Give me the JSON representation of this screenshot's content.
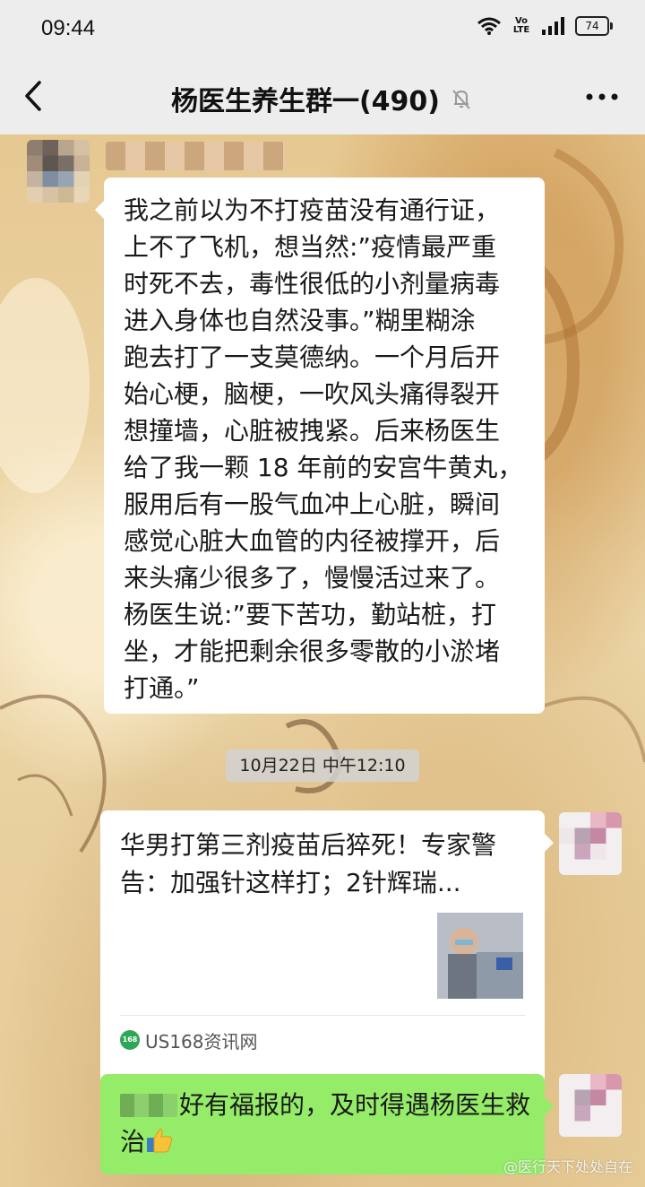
{
  "status_bar": {
    "time": "09:44",
    "network_label": "Vo LTE",
    "battery": "74"
  },
  "header": {
    "title": "杨医生养生群一(490)"
  },
  "messages": [
    {
      "text": "我之前以为不打疫苗没有通行证，\n上不了飞机，想当然:”疫情最严重\n时死不去，毒性很低的小剂量病毒\n进入身体也自然没事。”糊里糊涂\n跑去打了一支莫德纳。一个月后开\n始心梗，脑梗，一吹风头痛得裂开\n想撞墙，心脏被拽紧。后来杨医生\n给了我一颗 18 年前的安宫牛黄丸，\n服用后有一股气血冲上心脏，瞬间\n感觉心脏大血管的内径被撑开，后\n来头痛少很多了，慢慢活过来了。\n杨医生说:”要下苦功，勤站桩，打\n坐，才能把剩余很多零散的小淤堵\n打通。”"
    }
  ],
  "timestamp": "10月22日 中午12:10",
  "link_card": {
    "title": "华男打第三剂疫苗后猝死！专家警告：加强针这样打；2针辉瑞...",
    "source_badge": "168",
    "source": "US168资讯网"
  },
  "reply": {
    "text": "好有福报的，及时得遇杨医生救治"
  },
  "watermark": "@医行天下处处自在",
  "colors": {
    "green_bubble": "#95ec69",
    "bar_bg": "#ededed"
  }
}
